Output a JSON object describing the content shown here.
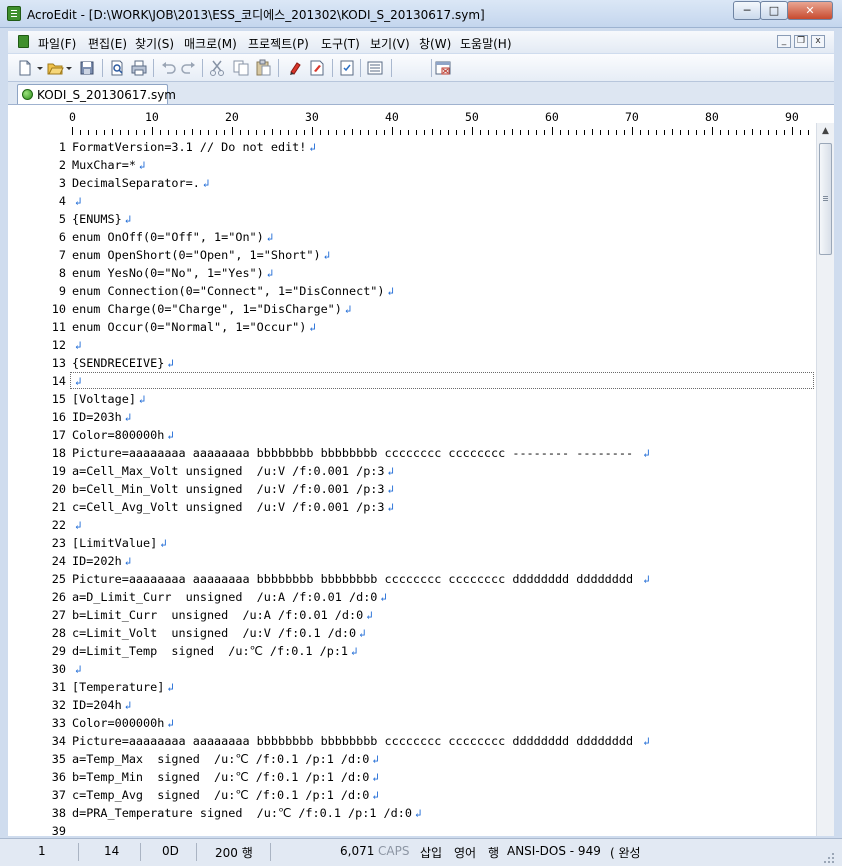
{
  "window": {
    "title": "AcroEdit - [D:\\WORK\\JOB\\2013\\ESS_코디에스_201302\\KODI_S_20130617.sym]",
    "min_glyph": "─",
    "max_glyph": "□",
    "close_glyph": "✕"
  },
  "menu": {
    "items": [
      "파일(F)",
      "편집(E)",
      "찾기(S)",
      "매크로(M)",
      "프로젝트(P)",
      "도구(T)",
      "보기(V)",
      "창(W)",
      "도움말(H)"
    ],
    "mdi_min": "_",
    "mdi_restore": "❐",
    "mdi_close": "x"
  },
  "toolbar": {
    "icons": [
      "new-file-icon",
      "open-folder-icon",
      "save-icon",
      "print-preview-icon",
      "print-icon",
      "undo-icon",
      "redo-icon",
      "cut-icon",
      "copy-icon",
      "paste-icon",
      "bookmark-icon",
      "bookmark-next-icon",
      "properties-icon",
      "list-icon",
      "close-window-icon"
    ]
  },
  "tab": {
    "label": "KODI_S_20130617.sym"
  },
  "ruler": {
    "labels": [
      "0",
      "10",
      "20",
      "30",
      "40",
      "50",
      "60",
      "70",
      "80",
      "90"
    ]
  },
  "eol_glyph": "↲",
  "editor": {
    "lines": [
      {
        "n": "1",
        "text": "FormatVersion=3.1 // Do not edit!"
      },
      {
        "n": "2",
        "text": "MuxChar=*"
      },
      {
        "n": "3",
        "text": "DecimalSeparator=."
      },
      {
        "n": "4",
        "text": ""
      },
      {
        "n": "5",
        "text": "{ENUMS}"
      },
      {
        "n": "6",
        "text": "enum OnOff(0=\"Off\", 1=\"On\")"
      },
      {
        "n": "7",
        "text": "enum OpenShort(0=\"Open\", 1=\"Short\")"
      },
      {
        "n": "8",
        "text": "enum YesNo(0=\"No\", 1=\"Yes\")"
      },
      {
        "n": "9",
        "text": "enum Connection(0=\"Connect\", 1=\"DisConnect\")"
      },
      {
        "n": "10",
        "text": "enum Charge(0=\"Charge\", 1=\"DisCharge\")"
      },
      {
        "n": "11",
        "text": "enum Occur(0=\"Normal\", 1=\"Occur\")"
      },
      {
        "n": "12",
        "text": ""
      },
      {
        "n": "13",
        "text": "{SENDRECEIVE}"
      },
      {
        "n": "14",
        "text": ""
      },
      {
        "n": "15",
        "text": "[Voltage]"
      },
      {
        "n": "16",
        "text": "ID=203h"
      },
      {
        "n": "17",
        "text": "Color=800000h"
      },
      {
        "n": "18",
        "text": "Picture=aaaaaaaa aaaaaaaa bbbbbbbb bbbbbbbb cccccccc cccccccc -------- -------- "
      },
      {
        "n": "19",
        "text": "a=Cell_Max_Volt unsigned  /u:V /f:0.001 /p:3"
      },
      {
        "n": "20",
        "text": "b=Cell_Min_Volt unsigned  /u:V /f:0.001 /p:3"
      },
      {
        "n": "21",
        "text": "c=Cell_Avg_Volt unsigned  /u:V /f:0.001 /p:3"
      },
      {
        "n": "22",
        "text": ""
      },
      {
        "n": "23",
        "text": "[LimitValue]"
      },
      {
        "n": "24",
        "text": "ID=202h"
      },
      {
        "n": "25",
        "text": "Picture=aaaaaaaa aaaaaaaa bbbbbbbb bbbbbbbb cccccccc cccccccc dddddddd dddddddd "
      },
      {
        "n": "26",
        "text": "a=D_Limit_Curr  unsigned  /u:A /f:0.01 /d:0"
      },
      {
        "n": "27",
        "text": "b=Limit_Curr  unsigned  /u:A /f:0.01 /d:0"
      },
      {
        "n": "28",
        "text": "c=Limit_Volt  unsigned  /u:V /f:0.1 /d:0"
      },
      {
        "n": "29",
        "text": "d=Limit_Temp  signed  /u:℃ /f:0.1 /p:1"
      },
      {
        "n": "30",
        "text": ""
      },
      {
        "n": "31",
        "text": "[Temperature]"
      },
      {
        "n": "32",
        "text": "ID=204h"
      },
      {
        "n": "33",
        "text": "Color=000000h"
      },
      {
        "n": "34",
        "text": "Picture=aaaaaaaa aaaaaaaa bbbbbbbb bbbbbbbb cccccccc cccccccc dddddddd dddddddd "
      },
      {
        "n": "35",
        "text": "a=Temp_Max  signed  /u:℃ /f:0.1 /p:1 /d:0"
      },
      {
        "n": "36",
        "text": "b=Temp_Min  signed  /u:℃ /f:0.1 /p:1 /d:0"
      },
      {
        "n": "37",
        "text": "c=Temp_Avg  signed  /u:℃ /f:0.1 /p:1 /d:0"
      },
      {
        "n": "38",
        "text": "d=PRA_Temperature signed  /u:℃ /f:0.1 /p:1 /d:0"
      },
      {
        "n": "39",
        "text": ""
      }
    ],
    "current_line": "14"
  },
  "statusbar": {
    "line": "1",
    "column": "14",
    "char_code": "0D",
    "line_count": "200 행",
    "size": "6,071",
    "caps": "CAPS",
    "insert_mode": "삽입",
    "language": "영어",
    "row_mode": "행",
    "encoding": "ANSI-DOS - 949",
    "ime": "( 완성"
  }
}
